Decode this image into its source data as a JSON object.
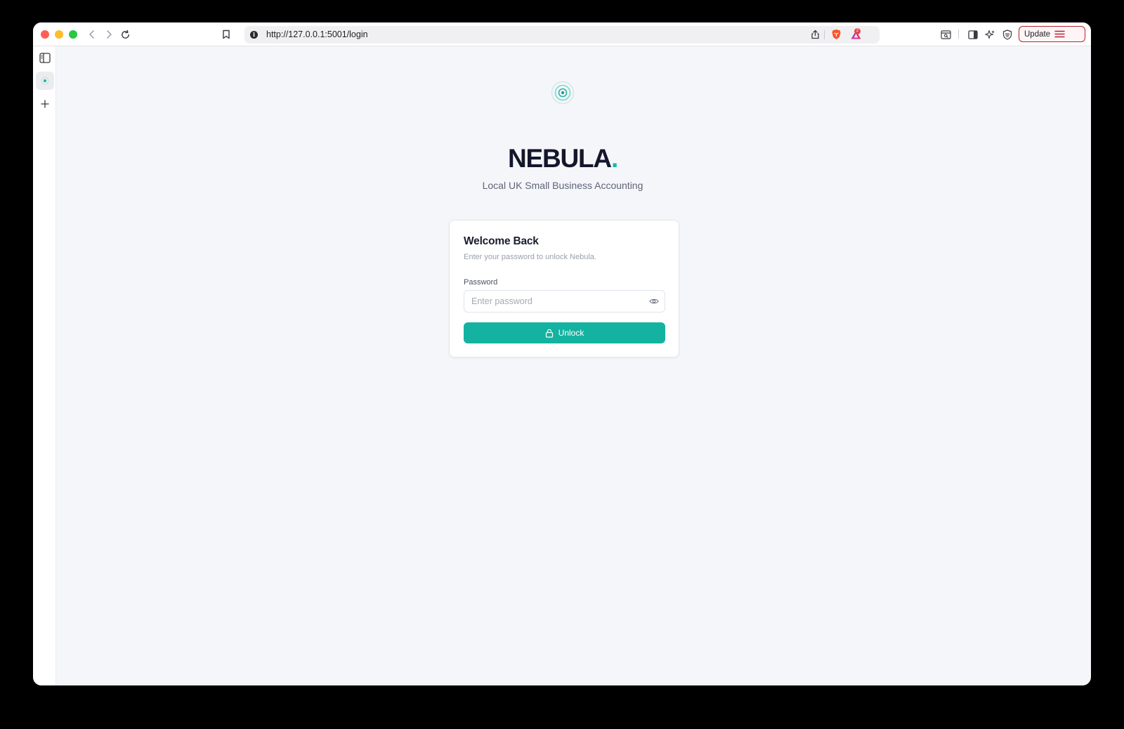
{
  "browser": {
    "url": "http://127.0.0.1:5001/login",
    "update_label": "Update",
    "notification_count": "2"
  },
  "brand": {
    "name": "NEBULA",
    "dot": ".",
    "tagline": "Local UK Small Business Accounting"
  },
  "login": {
    "title": "Welcome Back",
    "subtitle": "Enter your password to unlock Nebula.",
    "password_label": "Password",
    "password_placeholder": "Enter password",
    "unlock_label": "Unlock"
  },
  "colors": {
    "accent": "#14b8a6",
    "button": "#14b3a1",
    "update_border": "#b4232f"
  }
}
